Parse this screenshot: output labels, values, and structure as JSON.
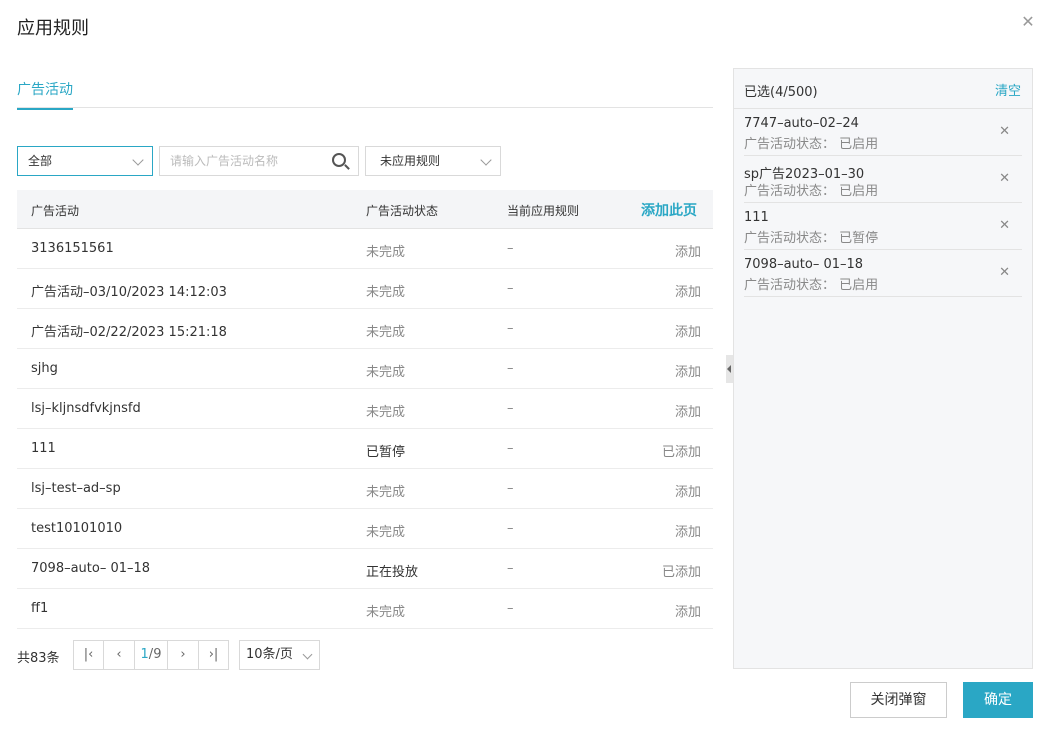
{
  "dialog": {
    "title": "应用规则",
    "close_icon": "close-icon"
  },
  "tabs": [
    {
      "label": "广告活动",
      "active": true
    }
  ],
  "filters": {
    "scope": "全部",
    "search_placeholder": "请输入广告活动名称",
    "rule_filter": "未应用规则"
  },
  "table": {
    "headers": {
      "campaign": "广告活动",
      "status": "广告活动状态",
      "rule": "当前应用规则",
      "add_page": "添加此页"
    },
    "rows": [
      {
        "campaign": "3136151561",
        "status": "未完成",
        "rule": "–",
        "action": "添加"
      },
      {
        "campaign": "广告活动–03/10/2023 14:12:03",
        "status": "未完成",
        "rule": "–",
        "action": "添加"
      },
      {
        "campaign": "广告活动–02/22/2023 15:21:18",
        "status": "未完成",
        "rule": "–",
        "action": "添加"
      },
      {
        "campaign": "sjhg",
        "status": "未完成",
        "rule": "–",
        "action": "添加"
      },
      {
        "campaign": "lsj–kljnsdfvkjnsfd",
        "status": "未完成",
        "rule": "–",
        "action": "添加"
      },
      {
        "campaign": "111",
        "status": "已暂停",
        "rule": "–",
        "action": "已添加"
      },
      {
        "campaign": "lsj–test–ad–sp",
        "status": "未完成",
        "rule": "–",
        "action": "添加"
      },
      {
        "campaign": "test10101010",
        "status": "未完成",
        "rule": "–",
        "action": "添加"
      },
      {
        "campaign": "7098–auto– 01–18",
        "status": "正在投放",
        "rule": "–",
        "action": "已添加"
      },
      {
        "campaign": "ff1",
        "status": "未完成",
        "rule": "–",
        "action": "添加"
      }
    ]
  },
  "pagination": {
    "total": "共83条",
    "current": "1",
    "separator": "/",
    "pages": "9",
    "page_size": "10条/页"
  },
  "selected_panel": {
    "count_label": "已选(4/500)",
    "clear_label": "清空",
    "items": [
      {
        "name": "7747–auto–02–24",
        "status": "广告活动状态：  已启用"
      },
      {
        "name": "sp广告2023–01–30",
        "status": "广告活动状态：  已启用"
      },
      {
        "name": "111",
        "status": "广告活动状态：  已暂停"
      },
      {
        "name": "7098–auto– 01–18",
        "status": "广告活动状态：  已启用"
      }
    ]
  },
  "footer": {
    "cancel_label": "关闭弹窗",
    "confirm_label": "确定"
  },
  "colors": {
    "accent": "#2aa7c5"
  }
}
